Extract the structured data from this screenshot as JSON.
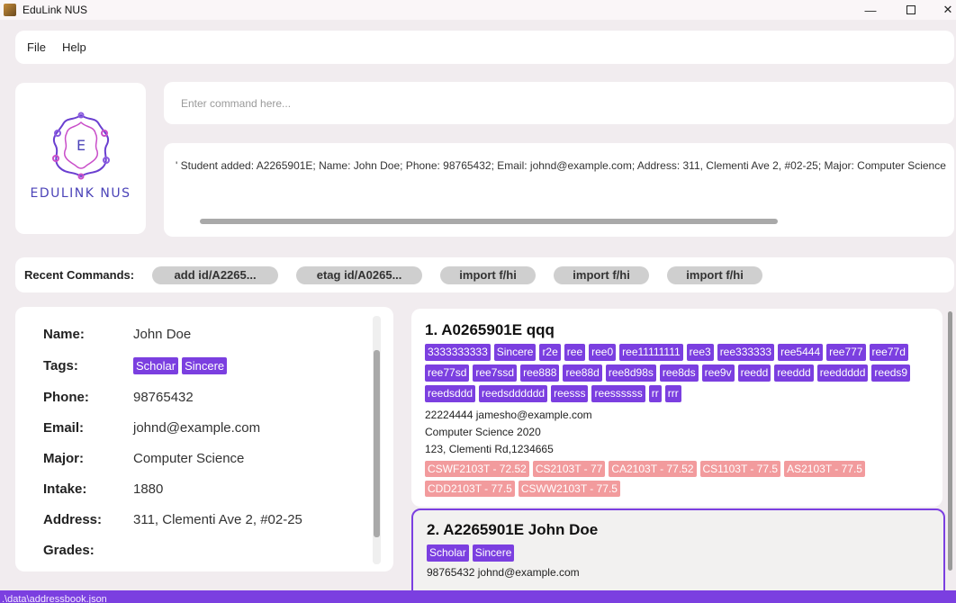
{
  "window": {
    "title": "EduLink NUS",
    "minimize": "—",
    "close": "✕"
  },
  "menu": {
    "file": "File",
    "help": "Help"
  },
  "logo": {
    "text": "EDULINK NUS",
    "letter": "E"
  },
  "command": {
    "placeholder": "Enter command here..."
  },
  "result": {
    "text": "' Student added: A2265901E; Name: John Doe; Phone: 98765432; Email: johnd@example.com; Address: 311, Clementi Ave 2, #02-25; Major: Computer Science"
  },
  "recent": {
    "label": "Recent Commands:",
    "items": [
      "add id/A2265...",
      "etag id/A0265...",
      "import f/hi",
      "import f/hi",
      "import f/hi"
    ]
  },
  "detail": {
    "name_label": "Name:",
    "name": "John Doe",
    "tags_label": "Tags:",
    "tags": [
      "Scholar",
      "Sincere"
    ],
    "phone_label": "Phone:",
    "phone": "98765432",
    "email_label": "Email:",
    "email": "johnd@example.com",
    "major_label": "Major:",
    "major": "Computer Science",
    "intake_label": "Intake:",
    "intake": "1880",
    "address_label": "Address:",
    "address": "311, Clementi Ave 2, #02-25",
    "grades_label": "Grades:"
  },
  "list": {
    "cards": [
      {
        "title": "1.  A0265901E qqq",
        "tags": [
          "3333333333",
          "Sincere",
          "r2e",
          "ree",
          "ree0",
          "ree11111111",
          "ree3",
          "ree333333",
          "ree5444",
          "ree777",
          "ree77d",
          "ree77sd",
          "ree7ssd",
          "ree888",
          "ree88d",
          "ree8d98s",
          "ree8ds",
          "ree9v",
          "reedd",
          "reeddd",
          "reeddddd",
          "reeds9",
          "reedsddd",
          "reedsdddddd",
          "reesss",
          "reessssss",
          "rr",
          "rrr"
        ],
        "contact": "22224444  jamesho@example.com",
        "major_intake": "Computer Science  2020",
        "address": "123, Clementi Rd,1234665",
        "grades": [
          "CSWF2103T - 72.52",
          "CS2103T - 77",
          "CA2103T - 77.52",
          "CS1103T - 77.5",
          "AS2103T - 77.5",
          "CDD2103T - 77.5",
          "CSWW2103T - 77.5"
        ]
      },
      {
        "title": "2.  A2265901E John Doe",
        "tags": [
          "Scholar",
          "Sincere"
        ],
        "contact": "98765432  johnd@example.com"
      }
    ]
  },
  "status": {
    "path": ".\\data\\addressbook.json"
  },
  "colors": {
    "accent": "#7b3fe0",
    "grade": "#f29b9d",
    "logo": "#4b43b8"
  }
}
